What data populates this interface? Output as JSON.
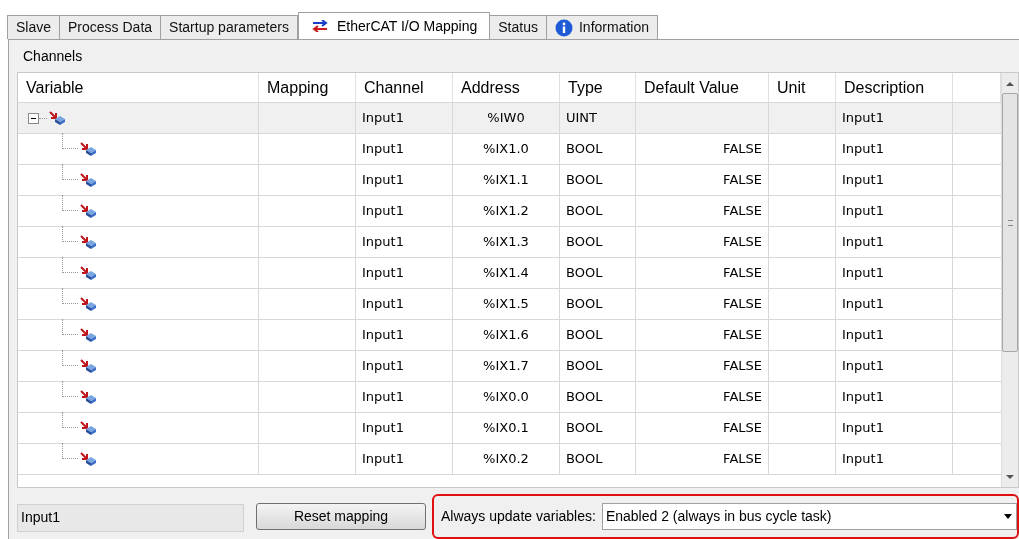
{
  "tabs": [
    {
      "label": "Slave",
      "selected": false,
      "kind": "plain"
    },
    {
      "label": "Process Data",
      "selected": false,
      "kind": "plain"
    },
    {
      "label": "Startup parameters",
      "selected": false,
      "kind": "plain"
    },
    {
      "label": "EtherCAT I/O Mapping",
      "selected": true,
      "kind": "mapping"
    },
    {
      "label": "Status",
      "selected": false,
      "kind": "plain"
    },
    {
      "label": "Information",
      "selected": false,
      "kind": "info"
    }
  ],
  "channels": {
    "title": "Channels",
    "table": {
      "columns": [
        "Variable",
        "Mapping",
        "Channel",
        "Address",
        "Type",
        "Default Value",
        "Unit",
        "Description"
      ],
      "rows": [
        {
          "selected": true,
          "expanded": true,
          "channel": "Input1",
          "address": "%IW0",
          "type": "UINT",
          "description": "Input1",
          "children": [
            {
              "channel": "Input1",
              "address": "%IX1.0",
              "type": "BOOL",
              "default_value": "FALSE",
              "description": "Input1"
            },
            {
              "channel": "Input1",
              "address": "%IX1.1",
              "type": "BOOL",
              "default_value": "FALSE",
              "description": "Input1"
            },
            {
              "channel": "Input1",
              "address": "%IX1.2",
              "type": "BOOL",
              "default_value": "FALSE",
              "description": "Input1"
            },
            {
              "channel": "Input1",
              "address": "%IX1.3",
              "type": "BOOL",
              "default_value": "FALSE",
              "description": "Input1"
            },
            {
              "channel": "Input1",
              "address": "%IX1.4",
              "type": "BOOL",
              "default_value": "FALSE",
              "description": "Input1"
            },
            {
              "channel": "Input1",
              "address": "%IX1.5",
              "type": "BOOL",
              "default_value": "FALSE",
              "description": "Input1"
            },
            {
              "channel": "Input1",
              "address": "%IX1.6",
              "type": "BOOL",
              "default_value": "FALSE",
              "description": "Input1"
            },
            {
              "channel": "Input1",
              "address": "%IX1.7",
              "type": "BOOL",
              "default_value": "FALSE",
              "description": "Input1"
            },
            {
              "channel": "Input1",
              "address": "%IX0.0",
              "type": "BOOL",
              "default_value": "FALSE",
              "description": "Input1"
            },
            {
              "channel": "Input1",
              "address": "%IX0.1",
              "type": "BOOL",
              "default_value": "FALSE",
              "description": "Input1"
            },
            {
              "channel": "Input1",
              "address": "%IX0.2",
              "type": "BOOL",
              "default_value": "FALSE",
              "description": "Input1"
            }
          ]
        }
      ]
    }
  },
  "footer": {
    "selected_variable": "Input1",
    "reset_button": "Reset mapping",
    "update_setting": {
      "label": "Always update variables:",
      "value": "Enabled 2 (always in bus cycle task)",
      "highlighted": true
    }
  }
}
